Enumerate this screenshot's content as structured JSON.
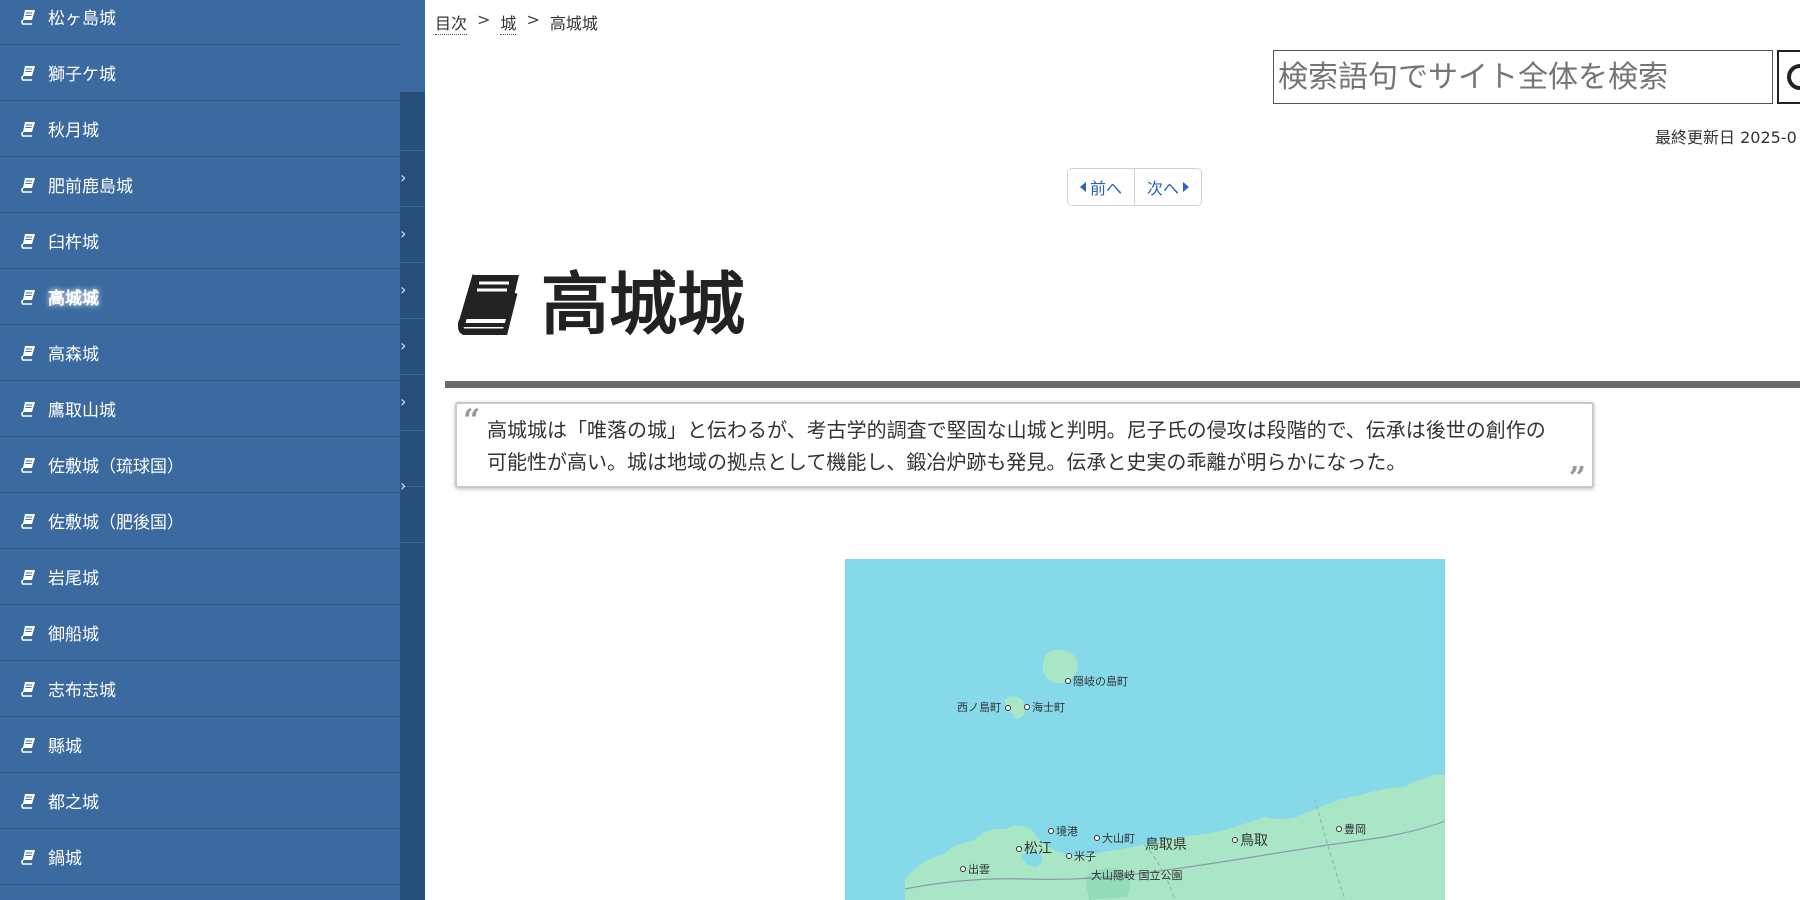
{
  "sidebar": {
    "items": [
      {
        "label": "松ヶ島城"
      },
      {
        "label": "獅子ケ城"
      },
      {
        "label": "秋月城"
      },
      {
        "label": "肥前鹿島城"
      },
      {
        "label": "臼杵城"
      },
      {
        "label": "高城城",
        "active": true
      },
      {
        "label": "高森城"
      },
      {
        "label": "鷹取山城"
      },
      {
        "label": "佐敷城（琉球国）"
      },
      {
        "label": "佐敷城（肥後国）"
      },
      {
        "label": "岩尾城"
      },
      {
        "label": "御船城"
      },
      {
        "label": "志布志城"
      },
      {
        "label": "縣城"
      },
      {
        "label": "都之城"
      },
      {
        "label": "鍋城"
      }
    ]
  },
  "breadcrumb": {
    "home": "目次",
    "separator": ">",
    "category": "城",
    "current": "高城城"
  },
  "search": {
    "placeholder": "検索語句でサイト全体を検索"
  },
  "last_updated": "最終更新日 2025-0",
  "pager": {
    "prev": "前へ",
    "next": "次へ"
  },
  "page": {
    "title": "高城城",
    "summary": "高城城は「唯落の城」と伝わるが、考古学的調査で堅固な山城と判明。尼子氏の侵攻は段階的で、伝承は後世の創作の可能性が高い。城は地域の拠点として機能し、鍛冶炉跡も発見。伝承と史実の乖離が明らかになった。"
  },
  "map": {
    "labels": {
      "okinoshima": "隠岐の島町",
      "nishinoshima": "西ノ島町",
      "ama": "海士町",
      "sakaiminato": "境港",
      "daisen": "大山町",
      "tottori_pref": "鳥取県",
      "tottori": "鳥取",
      "toyooka": "豊岡",
      "matsue": "松江",
      "yonago": "米子",
      "izumo": "出雲",
      "park": "大山隠岐 国立公園"
    },
    "colors": {
      "sea": "#86d9e9",
      "land": "#a8e6c6",
      "forest": "#b9e8cf"
    }
  },
  "colors": {
    "sidebar": "#3b6aa1",
    "rail": "#284f7a",
    "link": "#2a62c4"
  }
}
